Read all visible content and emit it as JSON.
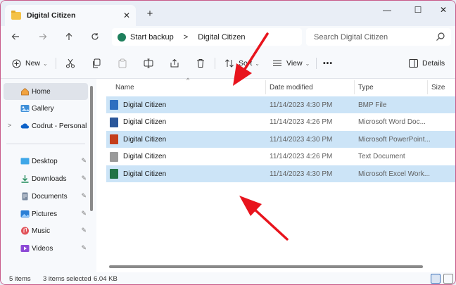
{
  "window": {
    "tab_title": "Digital Citizen",
    "new_tab_symbol": "+",
    "close_tab_symbol": "✕",
    "minimize_symbol": "—",
    "maximize_symbol": "☐",
    "close_symbol": "✕"
  },
  "address_bar": {
    "start_backup": "Start backup",
    "separator": ">",
    "location": "Digital Citizen",
    "search_placeholder": "Search Digital Citizen"
  },
  "toolbar": {
    "new_label": "New",
    "sort_label": "Sort",
    "view_label": "View",
    "more_label": "•••",
    "details_label": "Details"
  },
  "sidebar": {
    "items": [
      {
        "label": "Home",
        "icon": "home-icon"
      },
      {
        "label": "Gallery",
        "icon": "gallery-icon"
      },
      {
        "label": "Codrut - Personal",
        "icon": "cloud-icon"
      },
      {
        "label": "Desktop",
        "icon": "desktop-icon"
      },
      {
        "label": "Downloads",
        "icon": "download-icon"
      },
      {
        "label": "Documents",
        "icon": "documents-icon"
      },
      {
        "label": "Pictures",
        "icon": "pictures-icon"
      },
      {
        "label": "Music",
        "icon": "music-icon"
      },
      {
        "label": "Videos",
        "icon": "videos-icon"
      }
    ],
    "expand_symbol": ">",
    "pin_symbol": "📌"
  },
  "file_list": {
    "columns": {
      "name": "Name",
      "date": "Date modified",
      "type": "Type",
      "size": "Size"
    },
    "rows": [
      {
        "name": "Digital Citizen",
        "date": "11/14/2023 4:30 PM",
        "type": "BMP File",
        "selected": true,
        "icon": "bmp-file-icon",
        "color": "#2f6fc0"
      },
      {
        "name": "Digital Citizen",
        "date": "11/14/2023 4:26 PM",
        "type": "Microsoft Word Doc...",
        "selected": false,
        "icon": "word-file-icon",
        "color": "#2b579a"
      },
      {
        "name": "Digital Citizen",
        "date": "11/14/2023 4:30 PM",
        "type": "Microsoft PowerPoint...",
        "selected": true,
        "icon": "powerpoint-file-icon",
        "color": "#c43e1c"
      },
      {
        "name": "Digital Citizen",
        "date": "11/14/2023 4:26 PM",
        "type": "Text Document",
        "selected": false,
        "icon": "text-file-icon",
        "color": "#9a9a9a"
      },
      {
        "name": "Digital Citizen",
        "date": "11/14/2023 4:30 PM",
        "type": "Microsoft Excel Work...",
        "selected": true,
        "icon": "excel-file-icon",
        "color": "#217346"
      }
    ]
  },
  "status_bar": {
    "item_count": "5 items",
    "selection": "3 items selected",
    "size": "6.04 KB"
  },
  "colors": {
    "selection": "#cce4f7",
    "annotation_arrow": "#e8141d"
  }
}
